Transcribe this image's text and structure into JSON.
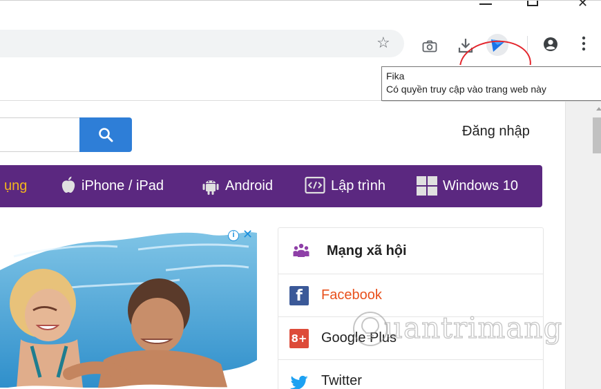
{
  "tooltip": {
    "title": "Fika",
    "subtitle": "Có quyền truy cập vào trang web này"
  },
  "header": {
    "login_label": "Đăng nhập"
  },
  "nav": {
    "items": [
      {
        "label": "ụng",
        "icon": "none"
      },
      {
        "label": "iPhone / iPad",
        "icon": "apple-icon"
      },
      {
        "label": "Android",
        "icon": "android-icon"
      },
      {
        "label": "Lập trình",
        "icon": "code-icon"
      },
      {
        "label": "Windows 10",
        "icon": "windows-icon"
      }
    ],
    "accent_color": "#f3b51d",
    "background_color": "#5b2880"
  },
  "ad": {
    "info_glyph": "i",
    "close_glyph": "✕"
  },
  "social": {
    "title": "Mạng xã hội",
    "items": [
      {
        "label": "Facebook",
        "icon": "facebook-icon",
        "icon_text": "f"
      },
      {
        "label": "Google Plus",
        "icon": "google-plus-icon",
        "icon_text": "8+"
      },
      {
        "label": "Twitter",
        "icon": "twitter-icon",
        "icon_text": ""
      }
    ]
  },
  "watermark": {
    "text": "uantrimang"
  },
  "colors": {
    "search_button": "#2e7ed7",
    "highlight_ring": "#e3262d",
    "facebook_label": "#e8501c"
  }
}
